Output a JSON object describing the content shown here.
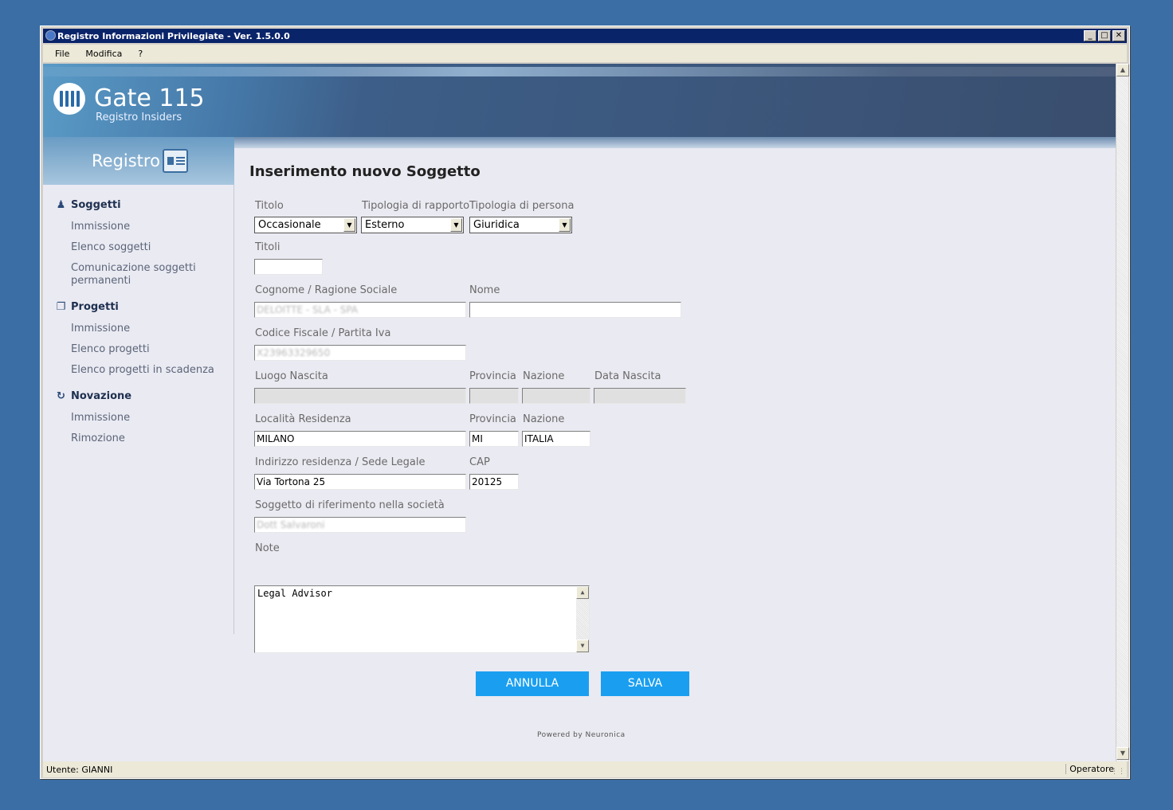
{
  "window": {
    "title": "Registro Informazioni Privilegiate - Ver. 1.5.0.0",
    "controls": {
      "minimize": "_",
      "maximize": "□",
      "close": "✕"
    }
  },
  "menu": [
    "File",
    "Modifica",
    "?"
  ],
  "header": {
    "logo_title": "Gate 115",
    "logo_subtitle": "Registro Insiders"
  },
  "sidebar": {
    "title": "Registro",
    "sections": [
      {
        "label": "Soggetti",
        "icon": "person-icon",
        "items": [
          "Immissione",
          "Elenco soggetti",
          "Comunicazione soggetti permanenti"
        ]
      },
      {
        "label": "Progetti",
        "icon": "documents-icon",
        "items": [
          "Immissione",
          "Elenco progetti",
          "Elenco progetti in scadenza"
        ]
      },
      {
        "label": "Novazione",
        "icon": "refresh-icon",
        "items": [
          "Immissione",
          "Rimozione"
        ]
      }
    ]
  },
  "form": {
    "title": "Inserimento nuovo Soggetto",
    "titolo": {
      "label": "Titolo",
      "value": "Occasionale"
    },
    "tipologia_rapporto": {
      "label": "Tipologia di rapporto",
      "value": "Esterno"
    },
    "tipologia_persona": {
      "label": "Tipologia di persona",
      "value": "Giuridica"
    },
    "titoli": {
      "label": "Titoli",
      "value": ""
    },
    "cognome": {
      "label": "Cognome / Ragione Sociale",
      "value": "DELOITTE - SLA - SPA"
    },
    "nome": {
      "label": "Nome",
      "value": ""
    },
    "codice_fiscale": {
      "label": "Codice Fiscale / Partita Iva",
      "value": "X23963329650"
    },
    "luogo_nascita": {
      "label": "Luogo Nascita",
      "value": ""
    },
    "provincia_nascita": {
      "label": "Provincia",
      "value": ""
    },
    "nazione_nascita": {
      "label": "Nazione",
      "value": ""
    },
    "data_nascita": {
      "label": "Data Nascita",
      "value": ""
    },
    "localita_residenza": {
      "label": "Località Residenza",
      "value": "MILANO"
    },
    "provincia_residenza": {
      "label": "Provincia",
      "value": "MI"
    },
    "nazione_residenza": {
      "label": "Nazione",
      "value": "ITALIA"
    },
    "indirizzo": {
      "label": "Indirizzo residenza / Sede Legale",
      "value": "Via Tortona 25"
    },
    "cap": {
      "label": "CAP",
      "value": "20125"
    },
    "soggetto_riferimento": {
      "label": "Soggetto di riferimento nella società",
      "value": "Dott Salvaroni"
    },
    "note": {
      "label": "Note",
      "value": "Legal Advisor"
    },
    "annulla_label": "ANNULLA",
    "salva_label": "SALVA"
  },
  "footer": {
    "powered": "Powered by Neuronica"
  },
  "status": {
    "user": "Utente: GIANNI",
    "role": "Operatore"
  }
}
